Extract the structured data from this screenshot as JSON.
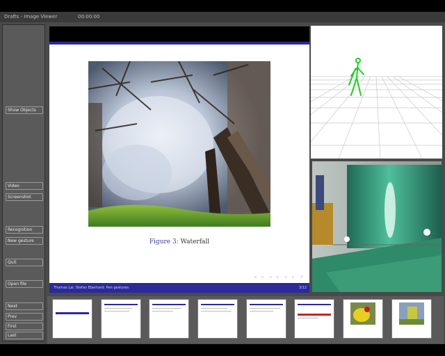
{
  "window": {
    "title": "Drafts - Image Viewer",
    "title_right": "00:00:00"
  },
  "sidebar": {
    "buttons": [
      {
        "label": "Show Objects"
      },
      {
        "label": "Video"
      },
      {
        "label": "Screenshot"
      },
      {
        "label": "Recognition"
      },
      {
        "label": "New gesture"
      },
      {
        "label": "Quit"
      },
      {
        "label": "Open file"
      },
      {
        "label": "Next"
      },
      {
        "label": "Prev"
      },
      {
        "label": "First"
      },
      {
        "label": "Last"
      }
    ]
  },
  "slide": {
    "figure_label": "Figure 3:",
    "caption": "Waterfall",
    "footer_left": "Thomas Lai, Stefan Eberhard: Pen gestures",
    "footer_right": "3/12"
  },
  "thumbnails": [
    {
      "kind": "title"
    },
    {
      "kind": "text"
    },
    {
      "kind": "text"
    },
    {
      "kind": "text"
    },
    {
      "kind": "text"
    },
    {
      "kind": "redline"
    },
    {
      "kind": "image-yellow"
    },
    {
      "kind": "image-blue"
    }
  ],
  "colors": {
    "accent": "#2a2a9a",
    "skeleton": "#22cc22",
    "panel_bg": "#4a4a4a"
  }
}
